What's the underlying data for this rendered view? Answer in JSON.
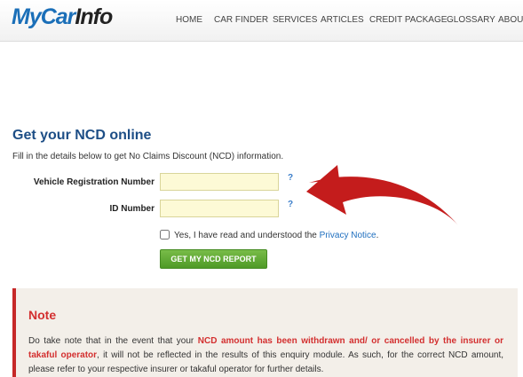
{
  "header": {
    "logo": {
      "part1": "MyCar",
      "part2": "Info"
    },
    "nav": [
      "HOME",
      "CAR FINDER",
      "SERVICES",
      "ARTICLES",
      "CREDIT PACKAGE",
      "GLOSSARY",
      "ABOUT"
    ]
  },
  "form": {
    "title": "Get your NCD online",
    "intro": "Fill in the details below to get No Claims Discount (NCD) information.",
    "vehicle_label": "Vehicle Registration Number",
    "vehicle_value": "",
    "id_label": "ID Number",
    "id_value": "",
    "help": "?",
    "agree_prefix": "Yes, I have read and understood the ",
    "agree_link": "Privacy Notice",
    "agree_suffix": ".",
    "submit": "GET MY NCD REPORT"
  },
  "note": {
    "title": "Note",
    "part1": "Do take note that in the event that your ",
    "highlight1": "NCD amount has been withdrawn and/ or cancelled by the insurer or takaful operator",
    "part2": ", it will not be reflected in the results of this enquiry module. As such, for the correct NCD amount, please refer to your respective insurer or takaful operator for further details."
  },
  "colors": {
    "brand_blue": "#1b6fb8",
    "title_blue": "#1d4e86",
    "button_green": "#5aa22f",
    "note_red": "#d32f2f",
    "arrow_red": "#c41c1c"
  },
  "icons": {
    "annotation": "red-curved-arrow"
  }
}
